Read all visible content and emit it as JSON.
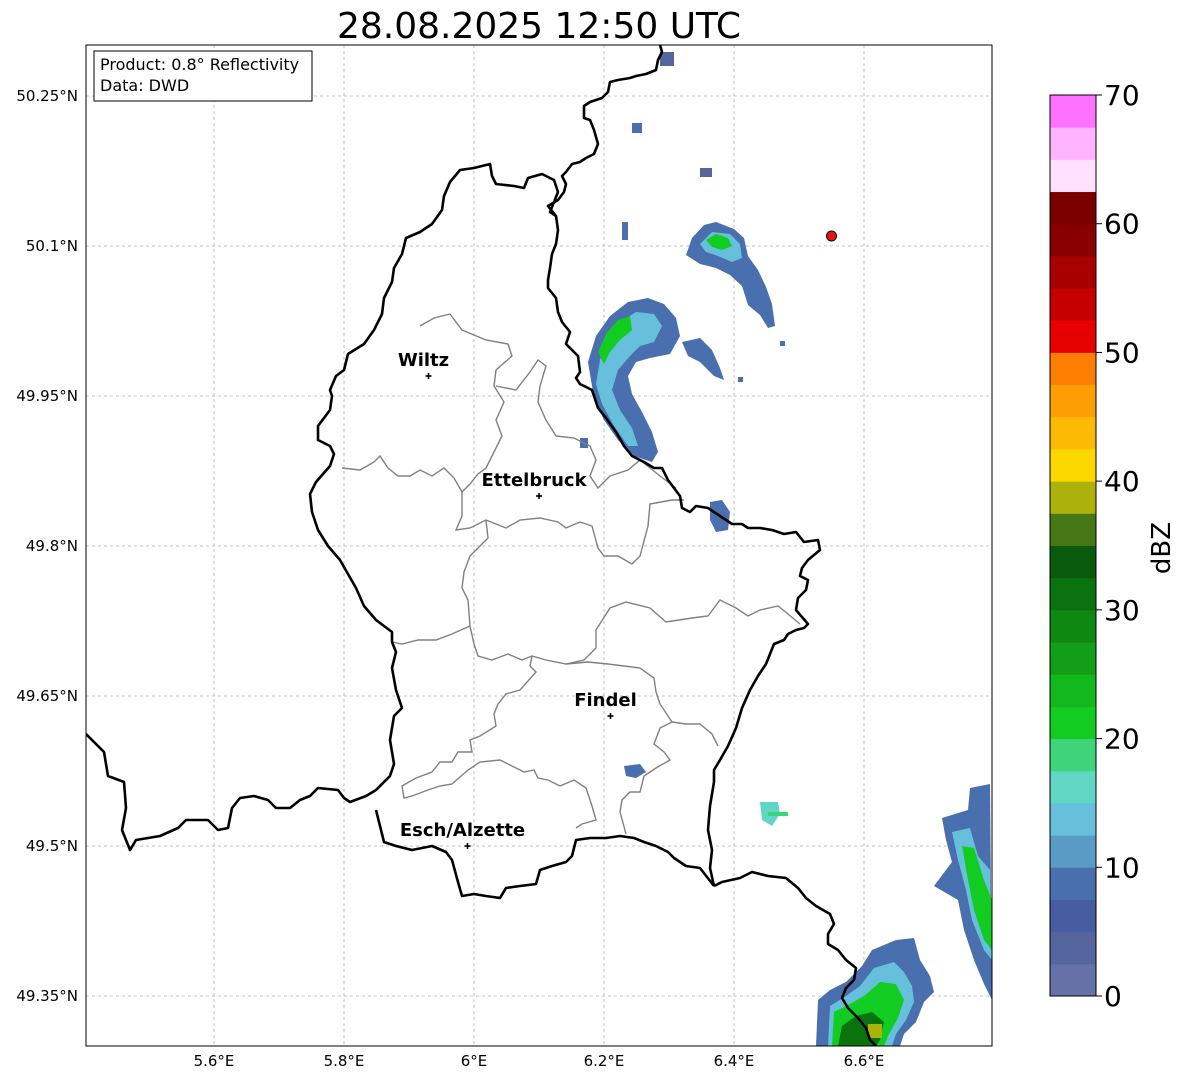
{
  "title": "28.08.2025 12:50 UTC",
  "info_box": {
    "product": "Product: 0.8° Reflectivity",
    "source": "Data: DWD"
  },
  "axes": {
    "lon_ticks": [
      "5.6°E",
      "5.8°E",
      "6°E",
      "6.2°E",
      "6.4°E",
      "6.6°E"
    ],
    "lat_ticks": [
      "50.25°N",
      "50.1°N",
      "49.95°N",
      "49.8°N",
      "49.65°N",
      "49.5°N",
      "49.35°N"
    ],
    "lon_range": [
      5.4,
      6.8
    ],
    "lat_range": [
      49.3,
      50.3
    ]
  },
  "cities": [
    {
      "name": "Wiltz",
      "lon": 5.93,
      "lat": 49.97
    },
    {
      "name": "Ettelbruck",
      "lon": 6.1,
      "lat": 49.85
    },
    {
      "name": "Findel",
      "lon": 6.21,
      "lat": 49.63
    },
    {
      "name": "Esch/Alzette",
      "lon": 5.99,
      "lat": 49.5
    }
  ],
  "marker": {
    "lon": 6.55,
    "lat": 50.11,
    "color": "#ee1111"
  },
  "colorbar": {
    "label": "dBZ",
    "ticks": [
      "0",
      "10",
      "20",
      "30",
      "40",
      "50",
      "60",
      "70"
    ],
    "colors": [
      "#6472a8",
      "#55669e",
      "#465da0",
      "#4a6fae",
      "#5a9bc6",
      "#66c0dc",
      "#62d6c4",
      "#3ed47a",
      "#13cc22",
      "#12b81c",
      "#129e16",
      "#0f8812",
      "#0a7310",
      "#0a5a0c",
      "#457714",
      "#acb20a",
      "#fdd700",
      "#fdba05",
      "#fd9e05",
      "#fc7f02",
      "#e60000",
      "#c60000",
      "#a80000",
      "#880000",
      "#7a0000",
      "#ffe0ff",
      "#ffb4ff",
      "#ff72ff",
      "#ee3cee"
    ]
  },
  "colors": {
    "border": "#000000",
    "cantons": "#808080",
    "grid": "#b0b0b0"
  }
}
